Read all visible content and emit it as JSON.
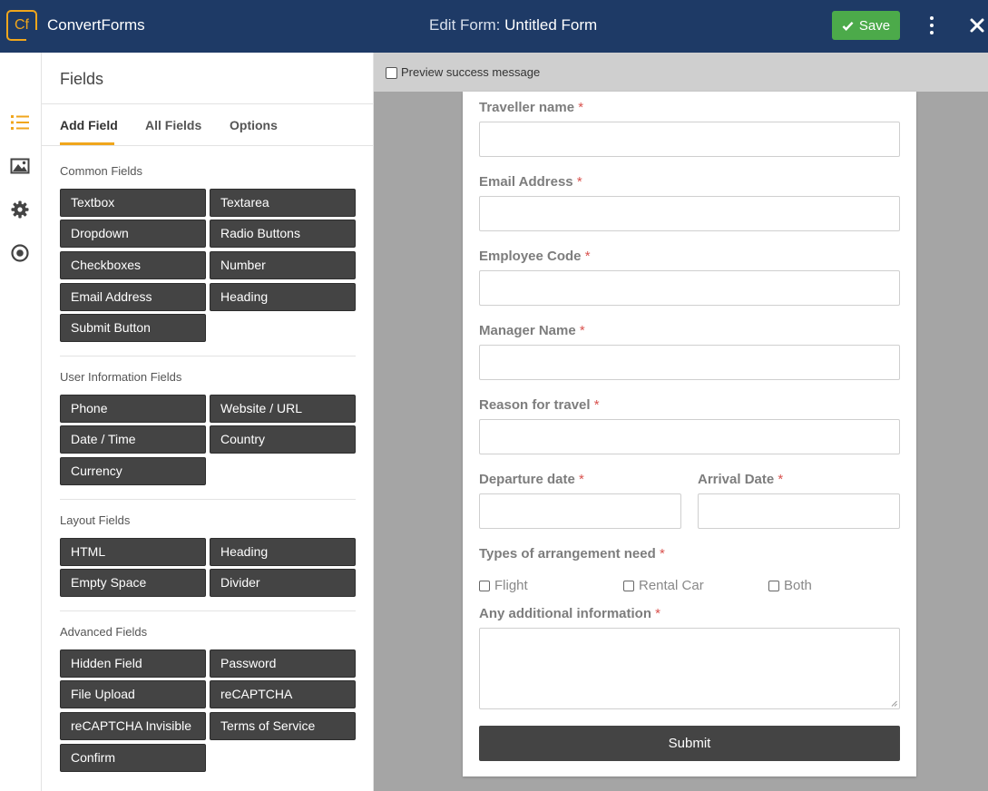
{
  "app": {
    "logo_text": "Cf",
    "brand": "ConvertForms"
  },
  "header": {
    "title_prefix": "Edit Form:",
    "title_name": "Untitled Form",
    "save_label": "Save"
  },
  "panel": {
    "title": "Fields",
    "tabs": [
      "Add Field",
      "All Fields",
      "Options"
    ],
    "groups": [
      {
        "title": "Common Fields",
        "buttons": [
          "Textbox",
          "Textarea",
          "Dropdown",
          "Radio Buttons",
          "Checkboxes",
          "Number",
          "Email Address",
          "Heading",
          "Submit Button"
        ]
      },
      {
        "title": "User Information Fields",
        "buttons": [
          "Phone",
          "Website / URL",
          "Date / Time",
          "Country",
          "Currency"
        ]
      },
      {
        "title": "Layout Fields",
        "buttons": [
          "HTML",
          "Heading",
          "Empty Space",
          "Divider"
        ]
      },
      {
        "title": "Advanced Fields",
        "buttons": [
          "Hidden Field",
          "Password",
          "File Upload",
          "reCAPTCHA",
          "reCAPTCHA Invisible",
          "Terms of Service",
          "Confirm"
        ]
      }
    ]
  },
  "preview": {
    "success_label": "Preview success message"
  },
  "form": {
    "required_mark": "*",
    "fields": [
      "Traveller name",
      "Email Address",
      "Employee Code",
      "Manager Name",
      "Reason for travel"
    ],
    "departure_label": "Departure date",
    "arrival_label": "Arrival Date",
    "arrangement_label": "Types of arrangement need",
    "arrangement_options": [
      "Flight",
      "Rental Car",
      "Both"
    ],
    "additional_label": "Any additional information",
    "submit_label": "Submit"
  },
  "colors": {
    "header_bg": "#1e3a66",
    "accent": "#f0a61c",
    "save_green": "#4caa4a",
    "field_btn": "#444444",
    "required": "#d9534f"
  },
  "icons": [
    "list-icon",
    "image-icon",
    "gear-icon",
    "target-icon",
    "check-icon",
    "more-vertical-icon",
    "close-icon"
  ]
}
